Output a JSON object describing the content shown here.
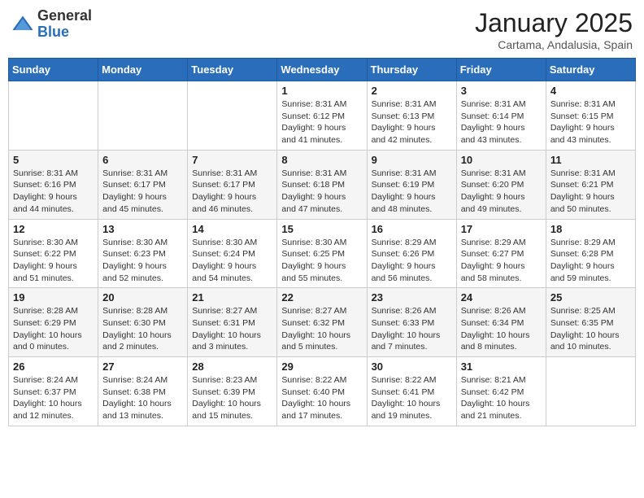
{
  "header": {
    "logo_general": "General",
    "logo_blue": "Blue",
    "month_title": "January 2025",
    "subtitle": "Cartama, Andalusia, Spain"
  },
  "weekdays": [
    "Sunday",
    "Monday",
    "Tuesday",
    "Wednesday",
    "Thursday",
    "Friday",
    "Saturday"
  ],
  "weeks": [
    [
      {
        "day": "",
        "info": ""
      },
      {
        "day": "",
        "info": ""
      },
      {
        "day": "",
        "info": ""
      },
      {
        "day": "1",
        "info": "Sunrise: 8:31 AM\nSunset: 6:12 PM\nDaylight: 9 hours and 41 minutes."
      },
      {
        "day": "2",
        "info": "Sunrise: 8:31 AM\nSunset: 6:13 PM\nDaylight: 9 hours and 42 minutes."
      },
      {
        "day": "3",
        "info": "Sunrise: 8:31 AM\nSunset: 6:14 PM\nDaylight: 9 hours and 43 minutes."
      },
      {
        "day": "4",
        "info": "Sunrise: 8:31 AM\nSunset: 6:15 PM\nDaylight: 9 hours and 43 minutes."
      }
    ],
    [
      {
        "day": "5",
        "info": "Sunrise: 8:31 AM\nSunset: 6:16 PM\nDaylight: 9 hours and 44 minutes."
      },
      {
        "day": "6",
        "info": "Sunrise: 8:31 AM\nSunset: 6:17 PM\nDaylight: 9 hours and 45 minutes."
      },
      {
        "day": "7",
        "info": "Sunrise: 8:31 AM\nSunset: 6:17 PM\nDaylight: 9 hours and 46 minutes."
      },
      {
        "day": "8",
        "info": "Sunrise: 8:31 AM\nSunset: 6:18 PM\nDaylight: 9 hours and 47 minutes."
      },
      {
        "day": "9",
        "info": "Sunrise: 8:31 AM\nSunset: 6:19 PM\nDaylight: 9 hours and 48 minutes."
      },
      {
        "day": "10",
        "info": "Sunrise: 8:31 AM\nSunset: 6:20 PM\nDaylight: 9 hours and 49 minutes."
      },
      {
        "day": "11",
        "info": "Sunrise: 8:31 AM\nSunset: 6:21 PM\nDaylight: 9 hours and 50 minutes."
      }
    ],
    [
      {
        "day": "12",
        "info": "Sunrise: 8:30 AM\nSunset: 6:22 PM\nDaylight: 9 hours and 51 minutes."
      },
      {
        "day": "13",
        "info": "Sunrise: 8:30 AM\nSunset: 6:23 PM\nDaylight: 9 hours and 52 minutes."
      },
      {
        "day": "14",
        "info": "Sunrise: 8:30 AM\nSunset: 6:24 PM\nDaylight: 9 hours and 54 minutes."
      },
      {
        "day": "15",
        "info": "Sunrise: 8:30 AM\nSunset: 6:25 PM\nDaylight: 9 hours and 55 minutes."
      },
      {
        "day": "16",
        "info": "Sunrise: 8:29 AM\nSunset: 6:26 PM\nDaylight: 9 hours and 56 minutes."
      },
      {
        "day": "17",
        "info": "Sunrise: 8:29 AM\nSunset: 6:27 PM\nDaylight: 9 hours and 58 minutes."
      },
      {
        "day": "18",
        "info": "Sunrise: 8:29 AM\nSunset: 6:28 PM\nDaylight: 9 hours and 59 minutes."
      }
    ],
    [
      {
        "day": "19",
        "info": "Sunrise: 8:28 AM\nSunset: 6:29 PM\nDaylight: 10 hours and 0 minutes."
      },
      {
        "day": "20",
        "info": "Sunrise: 8:28 AM\nSunset: 6:30 PM\nDaylight: 10 hours and 2 minutes."
      },
      {
        "day": "21",
        "info": "Sunrise: 8:27 AM\nSunset: 6:31 PM\nDaylight: 10 hours and 3 minutes."
      },
      {
        "day": "22",
        "info": "Sunrise: 8:27 AM\nSunset: 6:32 PM\nDaylight: 10 hours and 5 minutes."
      },
      {
        "day": "23",
        "info": "Sunrise: 8:26 AM\nSunset: 6:33 PM\nDaylight: 10 hours and 7 minutes."
      },
      {
        "day": "24",
        "info": "Sunrise: 8:26 AM\nSunset: 6:34 PM\nDaylight: 10 hours and 8 minutes."
      },
      {
        "day": "25",
        "info": "Sunrise: 8:25 AM\nSunset: 6:35 PM\nDaylight: 10 hours and 10 minutes."
      }
    ],
    [
      {
        "day": "26",
        "info": "Sunrise: 8:24 AM\nSunset: 6:37 PM\nDaylight: 10 hours and 12 minutes."
      },
      {
        "day": "27",
        "info": "Sunrise: 8:24 AM\nSunset: 6:38 PM\nDaylight: 10 hours and 13 minutes."
      },
      {
        "day": "28",
        "info": "Sunrise: 8:23 AM\nSunset: 6:39 PM\nDaylight: 10 hours and 15 minutes."
      },
      {
        "day": "29",
        "info": "Sunrise: 8:22 AM\nSunset: 6:40 PM\nDaylight: 10 hours and 17 minutes."
      },
      {
        "day": "30",
        "info": "Sunrise: 8:22 AM\nSunset: 6:41 PM\nDaylight: 10 hours and 19 minutes."
      },
      {
        "day": "31",
        "info": "Sunrise: 8:21 AM\nSunset: 6:42 PM\nDaylight: 10 hours and 21 minutes."
      },
      {
        "day": "",
        "info": ""
      }
    ]
  ]
}
